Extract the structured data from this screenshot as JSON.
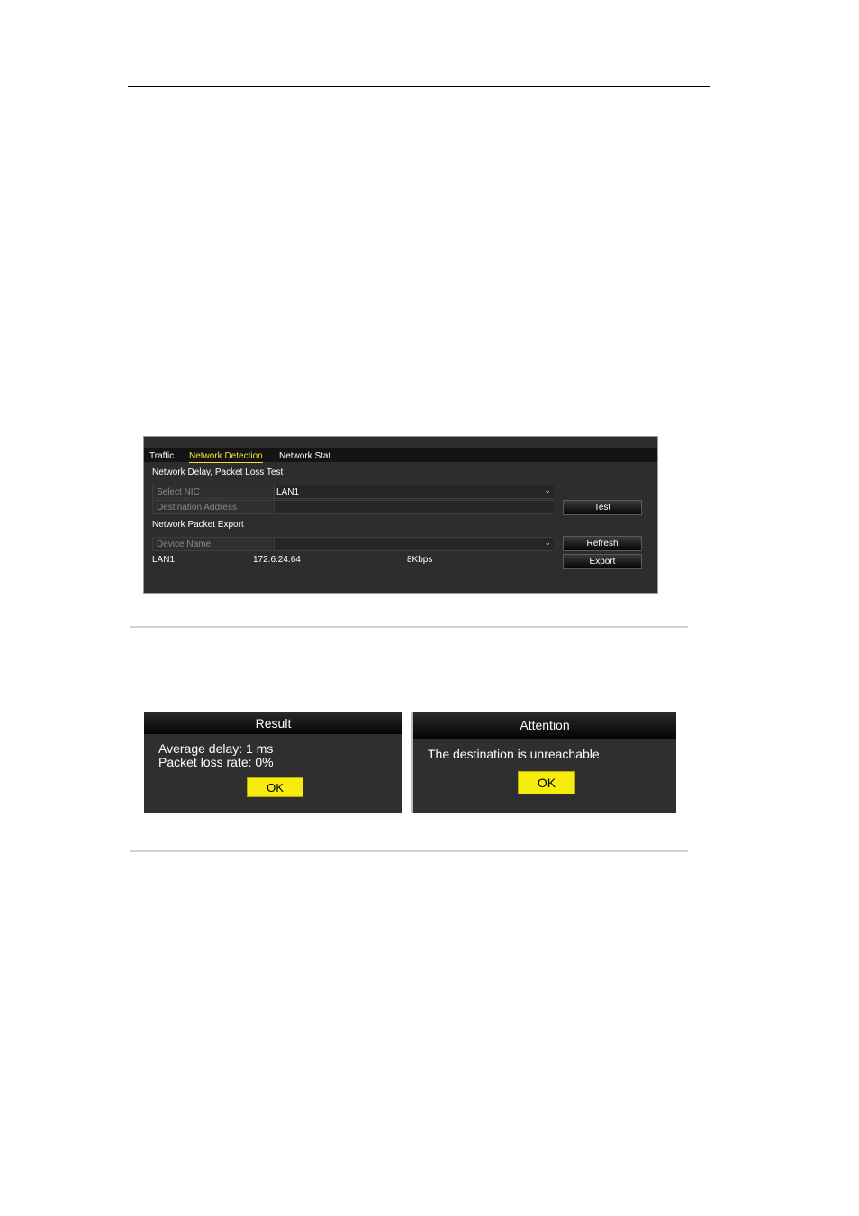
{
  "network_panel": {
    "tabs": [
      "Traffic",
      "Network Detection",
      "Network Stat."
    ],
    "delay_section_title": "Network Delay, Packet Loss Test",
    "select_nic_label": "Select NIC",
    "select_nic_value": "LAN1",
    "destination_label": "Destination Address",
    "destination_value": "",
    "test_button": "Test",
    "export_section_title": "Network Packet Export",
    "device_name_label": "Device Name",
    "device_name_value": "",
    "refresh_button": "Refresh",
    "export_button": "Export",
    "row": {
      "name": "LAN1",
      "ip": "172.6.24.64",
      "rate": "8Kbps"
    }
  },
  "result_dialog": {
    "title": "Result",
    "line1": "Average delay: 1 ms",
    "line2": "Packet loss rate: 0%",
    "ok": "OK"
  },
  "attention_dialog": {
    "title": "Attention",
    "message": "The destination is unreachable.",
    "ok": "OK"
  },
  "colors": {
    "panel_bg": "#2d2d2d",
    "active_tab": "#f6e13a",
    "ok_button": "#f6ec0d"
  }
}
